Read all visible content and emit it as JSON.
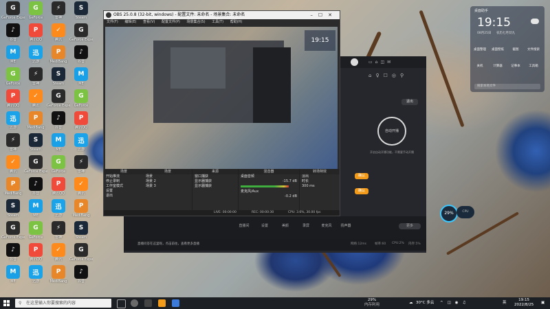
{
  "desktop_icons": [
    {
      "label": "GeForce Experience",
      "color": "#2b2b2b",
      "glyph": "G"
    },
    {
      "label": "抖音",
      "color": "#111",
      "glyph": "♪"
    },
    {
      "label": "ME",
      "color": "#1aa0e6",
      "glyph": "M"
    },
    {
      "label": "GeForce",
      "color": "#7cc243",
      "glyph": "G"
    },
    {
      "label": "腾讯QQ",
      "color": "#f04a3a",
      "glyph": "P"
    },
    {
      "label": "迅游",
      "color": "#1aa3e8",
      "glyph": "迅"
    },
    {
      "label": "雷神",
      "color": "#2a2a2a",
      "glyph": "⚡"
    },
    {
      "label": "腾讯",
      "color": "#ff8a1c",
      "glyph": "✓"
    },
    {
      "label": "MediBang",
      "color": "#e7872a",
      "glyph": "P"
    },
    {
      "label": "Steam",
      "color": "#1b2838",
      "glyph": "S"
    }
  ],
  "obs": {
    "title": "OBS 25.0.8 (32-bit, windows) - 配置文件: 未命名 - 场景集合: 未命名",
    "menu": [
      "文件(F)",
      "编辑(E)",
      "查看(V)",
      "配置文件(P)",
      "场景集合(S)",
      "工具(T)",
      "帮助(H)"
    ],
    "panels": {
      "scenes": "场景",
      "sources": "来源",
      "mixer": "混音器",
      "transitions": "转场特效",
      "controls": "控件"
    },
    "controls": [
      "开始推流",
      "停止录制",
      "工作室模式",
      "设置",
      "退出"
    ],
    "scenes": [
      "场景",
      "场景 2",
      "场景 3"
    ],
    "sources": [
      "窗口捕获",
      "显示器捕获",
      "显示器捕获"
    ],
    "mixer": [
      {
        "name": "桌面音频",
        "level": "-15.7 dB"
      },
      {
        "name": "麦克风/Aux",
        "level": "-0.2 dB"
      }
    ],
    "transition": {
      "name": "淡出",
      "duration_label": "时长",
      "duration": "300 ms"
    },
    "status": {
      "live": "LIVE: 00:00:00",
      "rec": "REC: 00:00:30",
      "cpu": "CPU: 3.6%, 30.00 fps"
    }
  },
  "app": {
    "buttons": {
      "exit": "退出",
      "auto_open": "自动开播",
      "confirm": "确认"
    },
    "caption": "开启自动开播功能，不需要手动开播",
    "bottom_items": [
      "直播间",
      "设置",
      "美颜",
      "录屏",
      "麦克风",
      "扬声器",
      "更多"
    ],
    "chat_hint": "直播问答在这里呢，点击前往，查看更多直播",
    "stats": [
      "网络:12ms",
      "帧率:60",
      "CPU:2%",
      "内存:5%",
      "设置"
    ],
    "counter_badge": "29%",
    "cpu_badge": "CPU"
  },
  "widget": {
    "title": "桌面助手",
    "time": "19:15",
    "date": "08月25日",
    "weekday": "农历七月廿九",
    "grid": [
      "桌面整理",
      "桌面壁纸",
      "截图",
      "文件搜索",
      "关机",
      "计算器",
      "记事本",
      "工具箱"
    ],
    "search_placeholder": "搜索本地文件"
  },
  "taskbar": {
    "search_placeholder": "在这里输入你要搜索的内容",
    "cpu_load": "29%",
    "cpu_label": "内存利用",
    "weather": "30°C 多云",
    "time": "19:15",
    "date": "2022/8/25",
    "lang": "英"
  }
}
